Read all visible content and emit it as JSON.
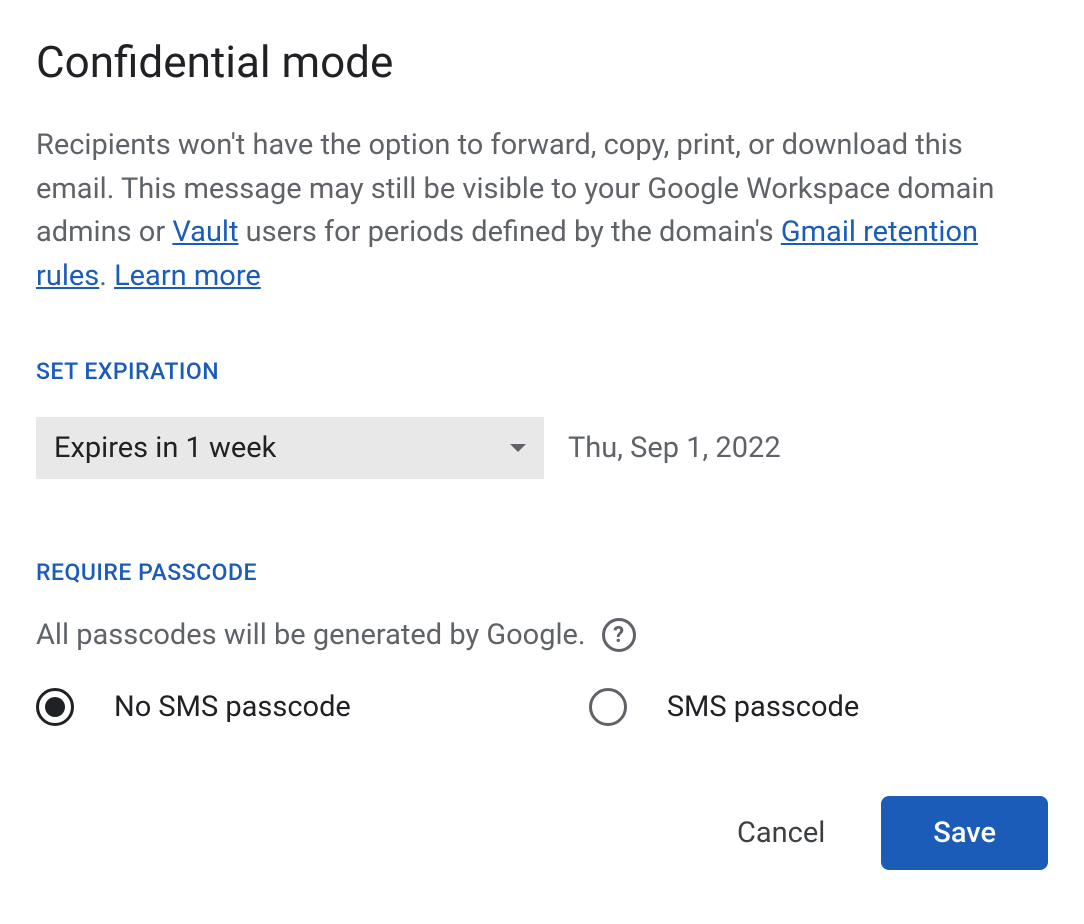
{
  "dialog": {
    "title": "Confidential mode",
    "description_prefix": "Recipients won't have the option to forward, copy, print, or download this email. This message may still be visible to your Google Workspace domain admins or ",
    "vault_link": "Vault",
    "description_mid": " users for periods defined by the domain's ",
    "retention_link": "Gmail retention rules",
    "description_suffix": ". ",
    "learn_more": "Learn more"
  },
  "expiration": {
    "section_label": "SET EXPIRATION",
    "selected": "Expires in 1 week",
    "date": "Thu, Sep 1, 2022"
  },
  "passcode": {
    "section_label": "REQUIRE PASSCODE",
    "subtitle": "All passcodes will be generated by Google.",
    "help_icon": "?",
    "options": {
      "no_sms": "No SMS passcode",
      "sms": "SMS passcode"
    }
  },
  "buttons": {
    "cancel": "Cancel",
    "save": "Save"
  }
}
